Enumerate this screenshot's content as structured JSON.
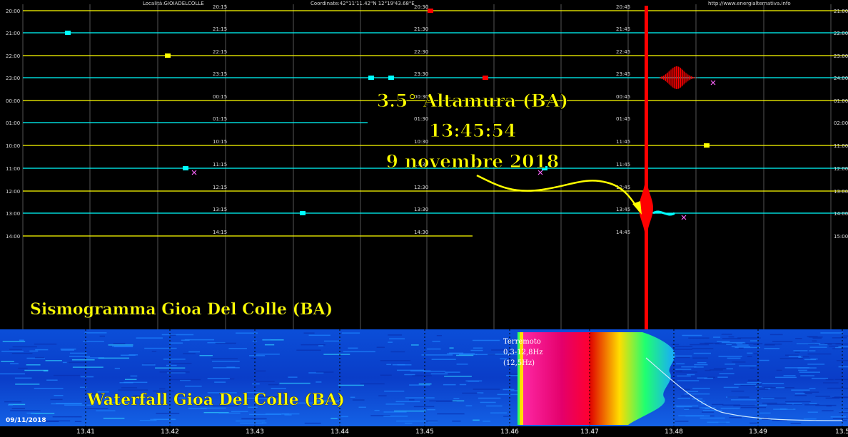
{
  "header": {
    "location": "Località:GIOIADELCOLLE",
    "coordinates": "Coordinate:42°11'11.42\"N  12°19'43.68\"E",
    "website": "http://www.energialternativa.info"
  },
  "seismogram": {
    "title": "Sismogramma Gioa Del Colle (BA)",
    "left_times": [
      "20:00",
      "21:00",
      "22:00",
      "23:00",
      "00:00",
      "01:00",
      "10:00",
      "11:00",
      "12:00",
      "13:00",
      "14:00"
    ],
    "right_times": [
      "21:00",
      "22:00",
      "23:00",
      "24:00",
      "01:00",
      "02:00",
      "11:00",
      "12:00",
      "13:00",
      "14:00",
      "15:00"
    ],
    "col_labels": [
      [
        "20:15",
        "21:15",
        "22:15",
        "23:15",
        "00:15",
        "01:15",
        "10:15",
        "11:15",
        "12:15",
        "13:15",
        "14:15"
      ],
      [
        "20:30",
        "21:30",
        "22:30",
        "23:30",
        "00:30",
        "01:30",
        "10:30",
        "11:30",
        "12:30",
        "13:30",
        "14:30"
      ],
      [
        "20:45",
        "21:45",
        "22:45",
        "23:45",
        "00:45",
        "01:45",
        "11:45",
        "11:45",
        "12:45",
        "13:45",
        "14:45"
      ]
    ],
    "trace_colors": [
      "#ffff00",
      "#00ffff",
      "#ffff00",
      "#00ffff",
      "#ffff00",
      "#00ffff",
      "#ffff00",
      "#00ffff",
      "#ffff00",
      "#00ffff",
      "#ffff00"
    ],
    "quake_color": "#ff0000"
  },
  "annotation": {
    "magnitude_place": "3.5° Altamura (BA)",
    "time": "13:45:54",
    "date": "9 novembre 2018"
  },
  "waterfall": {
    "title": "Waterfall Gioa Del Colle (BA)",
    "quake_label": "Terremoto",
    "band": "0,3-12,8Hz",
    "peak": "(12,5Hz)",
    "date": "09/11/2018",
    "axis_ticks": [
      "13.41",
      "13.42",
      "13.43",
      "13.44",
      "13.45",
      "13.46",
      "13.47",
      "13.48",
      "13.49",
      "13.5"
    ]
  },
  "chart_data": {
    "type": "heatmap",
    "title": "Sismogramma Gioa Del Colle (BA)",
    "rows_start_times": [
      "20:00",
      "21:00",
      "22:00",
      "23:00",
      "00:00",
      "01:00",
      "10:00",
      "11:00",
      "12:00",
      "13:00",
      "14:00"
    ],
    "event": {
      "time": "13:45:54",
      "magnitude": 3.5,
      "place": "Altamura (BA)",
      "date": "9 novembre 2018"
    },
    "waterfall": {
      "x_ticks": [
        "13.41",
        "13.42",
        "13.43",
        "13.44",
        "13.45",
        "13.46",
        "13.47",
        "13.48",
        "13.49",
        "13.5"
      ],
      "quake_start": 13.462,
      "quake_end": 13.482,
      "band_hz": [
        0.3,
        12.8
      ],
      "peak_hz": 12.5
    }
  }
}
